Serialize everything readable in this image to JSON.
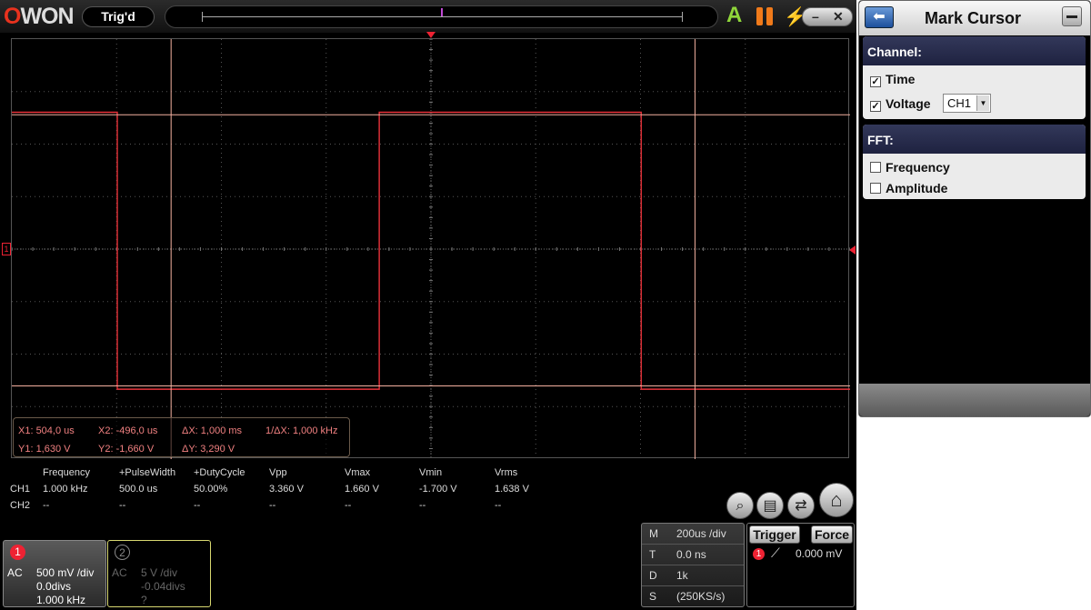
{
  "header": {
    "logo_prefix": "O",
    "logo_rest": "WON",
    "trigger_status": "Trig'd",
    "auto_label": "A",
    "winctl_min": "–",
    "winctl_close": "✕"
  },
  "cursor_readout": {
    "x1": "X1: 504,0 us",
    "x2": "X2: -496,0 us",
    "dx": "ΔX: 1,000 ms",
    "inv_dx": "1/ΔX: 1,000 kHz",
    "y1": "Y1: 1,630 V",
    "y2": "Y2: -1,660 V",
    "dy": "ΔY: 3,290 V"
  },
  "measurements": {
    "headers": [
      "Frequency",
      "+PulseWidth",
      "+DutyCycle",
      "Vpp",
      "Vmax",
      "Vmin",
      "Vrms"
    ],
    "rows": [
      {
        "channel": "CH1",
        "values": [
          "1.000 kHz",
          "500.0 us",
          "50.00%",
          "3.360 V",
          "1.660 V",
          "-1.700 V",
          "1.638 V"
        ]
      },
      {
        "channel": "CH2",
        "values": [
          "--",
          "--",
          "--",
          "--",
          "--",
          "--",
          "--"
        ]
      }
    ]
  },
  "ch1": {
    "num": "1",
    "coupling": "AC",
    "scale": "500 mV /div",
    "offset": "0.0divs",
    "freq": "1.000 kHz"
  },
  "ch2": {
    "num": "2",
    "coupling": "AC",
    "scale": "5 V /div",
    "offset": "-0.04divs",
    "freq": "?"
  },
  "timebase": {
    "rows": [
      {
        "key": "M",
        "value": "200us /div"
      },
      {
        "key": "T",
        "value": "0.0 ns"
      },
      {
        "key": "D",
        "value": "1k"
      },
      {
        "key": "S",
        "value": "(250KS/s)"
      }
    ]
  },
  "trigger": {
    "trigger_label": "Trigger",
    "force_label": "Force",
    "channel_num": "1",
    "level": "0.000 mV"
  },
  "side_panel": {
    "title": "Mark Cursor",
    "channel_group": "Channel:",
    "time_label": "Time",
    "time_checked": true,
    "voltage_label": "Voltage",
    "voltage_checked": true,
    "voltage_channel": "CH1",
    "fft_group": "FFT:",
    "frequency_label": "Frequency",
    "frequency_checked": false,
    "amplitude_label": "Amplitude",
    "amplitude_checked": false
  },
  "colors": {
    "trace": "#e8323a",
    "cursor": "#f4b0a0",
    "group_header": "#262a4a"
  },
  "waveform": {
    "high_level": 1.66,
    "low_level": -1.7,
    "volts_per_div": 0.5,
    "time_per_div_us": 200,
    "period_us": 1000,
    "duty": 0.5
  }
}
